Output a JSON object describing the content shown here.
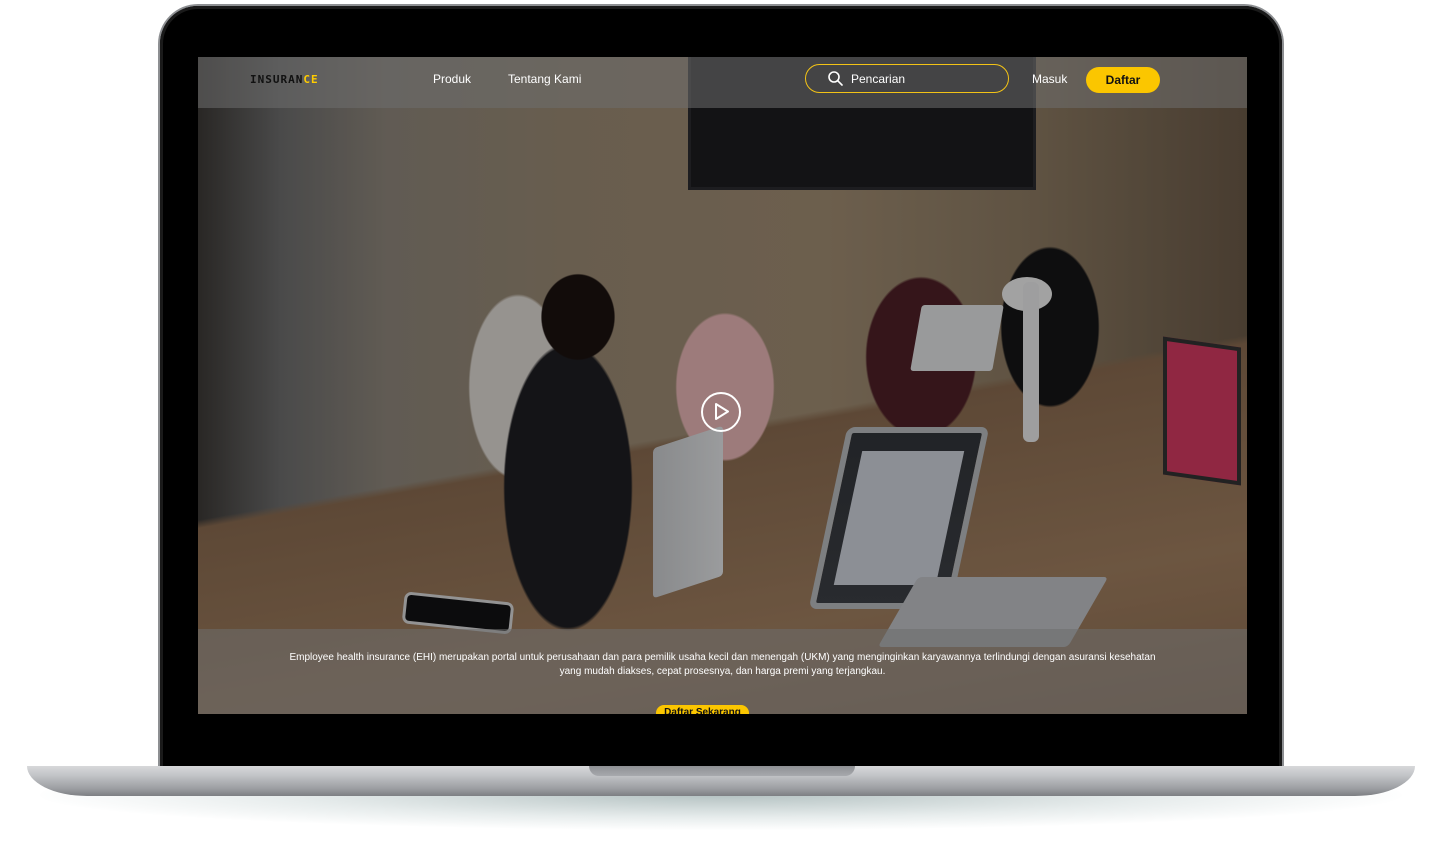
{
  "brand": {
    "logo_part_a": "INSURAN",
    "logo_part_b": "CE"
  },
  "nav": {
    "items": [
      {
        "label": "Produk"
      },
      {
        "label": "Tentang Kami"
      }
    ],
    "login_label": "Masuk",
    "register_label": "Daftar"
  },
  "search": {
    "placeholder": "Pencarian",
    "icon": "search-icon"
  },
  "hero": {
    "play_icon": "play-icon",
    "caption": "Employee health insurance (EHI) merupakan portal untuk perusahaan dan para pemilik usaha kecil dan menengah (UKM) yang menginginkan karyawannya terlindungi dengan asuransi kesehatan yang mudah diakses, cepat prosesnya, dan harga premi yang terjangkau.",
    "cta_label": "Daftar Sekarang"
  },
  "colors": {
    "accent": "#fbc600",
    "overlay": "#6e6e6e"
  }
}
